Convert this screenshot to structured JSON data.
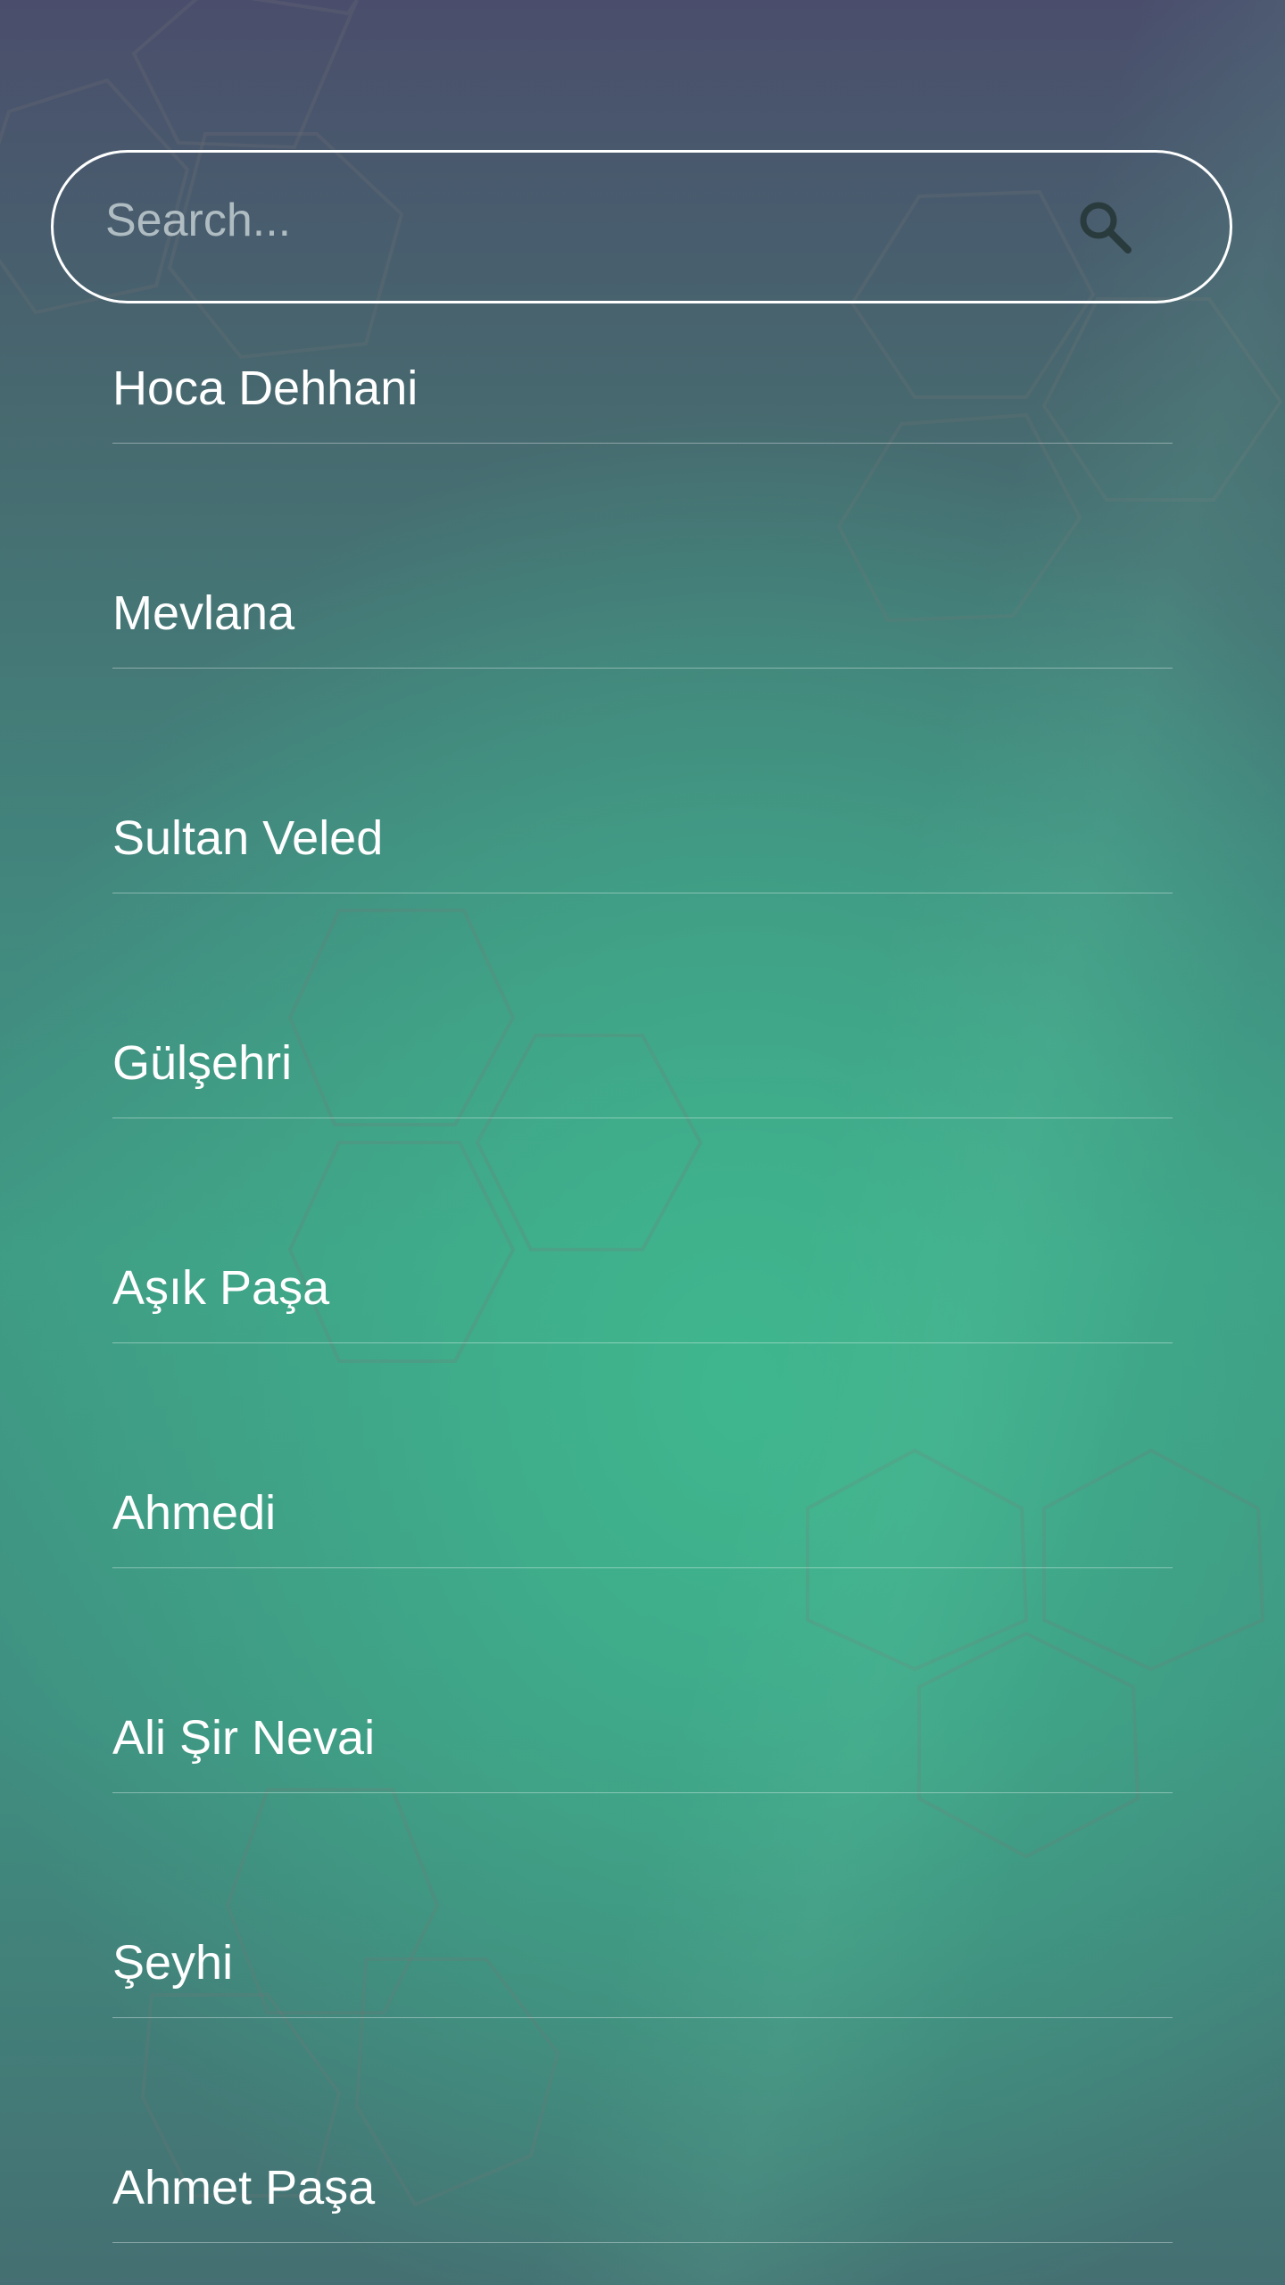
{
  "search": {
    "placeholder": "Search...",
    "value": "",
    "icon": "search-icon"
  },
  "items": [
    {
      "label": "Hoca Dehhani"
    },
    {
      "label": "Mevlana"
    },
    {
      "label": "Sultan Veled"
    },
    {
      "label": "Gülşehri"
    },
    {
      "label": "Aşık Paşa"
    },
    {
      "label": "Ahmedi"
    },
    {
      "label": "Ali Şir Nevai"
    },
    {
      "label": "Şeyhi"
    },
    {
      "label": "Ahmet Paşa"
    }
  ],
  "colors": {
    "text": "#ffffff",
    "search_icon": "#2a3b3d",
    "background_top": "#4a4e6c",
    "background_mid": "#3fb78e"
  }
}
